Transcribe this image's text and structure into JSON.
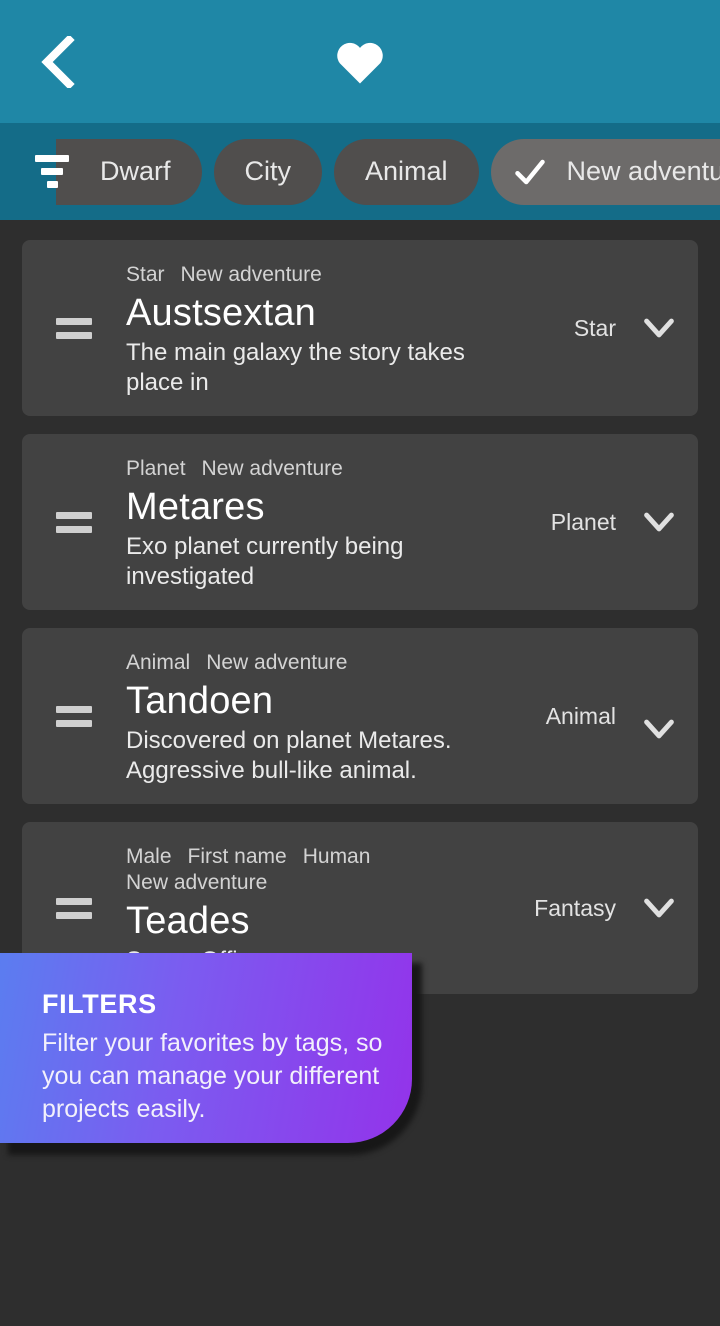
{
  "appbar": {
    "back_icon": "chevron-left-icon",
    "favorites_icon": "heart-icon",
    "title": ""
  },
  "filterbar": {
    "filter_icon": "filter-icon",
    "chips": [
      {
        "label": "Dwarf",
        "selected": false,
        "clipped": true
      },
      {
        "label": "City",
        "selected": false,
        "clipped": false
      },
      {
        "label": "Animal",
        "selected": false,
        "clipped": false
      },
      {
        "label": "New adventure",
        "selected": true,
        "clipped": false
      }
    ]
  },
  "list": {
    "items": [
      {
        "drag_icon": "drag-handle-icon",
        "tags": [
          "Star",
          "New adventure"
        ],
        "title": "Austsextan",
        "description": "The main galaxy the story takes place in",
        "category": "Star",
        "expand_icon": "chevron-down-icon"
      },
      {
        "drag_icon": "drag-handle-icon",
        "tags": [
          "Planet",
          "New adventure"
        ],
        "title": "Metares",
        "description": "Exo planet currently being investigated",
        "category": "Planet",
        "expand_icon": "chevron-down-icon"
      },
      {
        "drag_icon": "drag-handle-icon",
        "tags": [
          "Animal",
          "New adventure"
        ],
        "title": "Tandoen",
        "description": "Discovered on planet Metares. Aggressive bull-like animal.",
        "category": "Animal",
        "expand_icon": "chevron-down-icon"
      },
      {
        "drag_icon": "drag-handle-icon",
        "tags": [
          "Male",
          "First name",
          "Human",
          "New adventure"
        ],
        "title": "Teades",
        "description": "Space Officer",
        "category": "Fantasy",
        "expand_icon": "chevron-down-icon"
      }
    ]
  },
  "coachmark": {
    "title": "FILTERS",
    "text": "Filter your favorites by tags, so you can manage your different projects easily."
  },
  "colors": {
    "appbar": "#1f87a6",
    "filterbar": "#146c88",
    "page_background": "#2e2e2e",
    "card": "#424242",
    "chip": "#504e4d",
    "chip_selected": "#6d6b6a",
    "coach_gradient_start": "#5b7df0",
    "coach_gradient_end": "#9333ea"
  }
}
